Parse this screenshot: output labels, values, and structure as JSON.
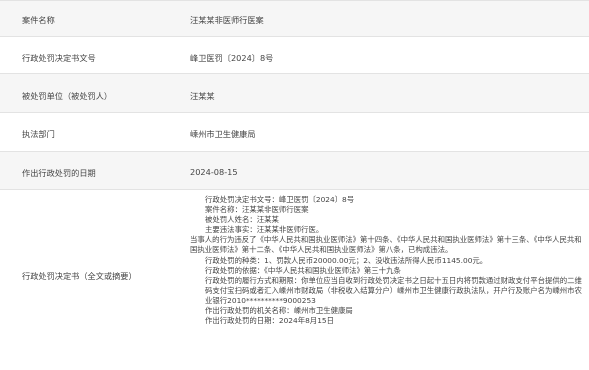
{
  "rows": [
    {
      "label": "案件名称",
      "value": "汪某某非医师行医案"
    },
    {
      "label": "行政处罚决定书文号",
      "value": "峰卫医罚〔2024〕8号"
    },
    {
      "label": "被处罚单位（被处罚人）",
      "value": "汪某某"
    },
    {
      "label": "执法部门",
      "value": "嵊州市卫生健康局"
    },
    {
      "label": "作出行政处罚的日期",
      "value": "2024-08-15"
    }
  ],
  "decision": {
    "label": "行政处罚决定书（全文或摘要）",
    "lines": [
      "行政处罚决定书文号：峰卫医罚〔2024〕8号",
      "案件名称：汪某某非医师行医案",
      "被处罚人姓名：汪某某",
      "主要违法事实：汪某某非医师行医。",
      "当事人的行为违反了《中华人民共和国执业医师法》第十四条、《中华人民共和国执业医师法》第十三条、《中华人民共和国执业医师法》第十二条、《中华人民共和国执业医师法》第八条，已构成违法。",
      "行政处罚的种类：1、罚款人民币20000.00元；2、没收违法所得人民币1145.00元。",
      "行政处罚的依据：《中华人民共和国执业医师法》第三十九条",
      "行政处罚的履行方式和期限：你单位应当自收到行政处罚决定书之日起十五日内将罚款通过财政支付平台提供的二维码支付宝扫码或者汇入嵊州市财政局（非税收入结算分户）嵊州市卫生健康行政执法队，开户行及账户名为嵊州市农业银行2010**********9000253",
      "作出行政处罚的机关名称：嵊州市卫生健康局",
      "作出行政处罚的日期：2024年8月15日"
    ]
  },
  "colors": {
    "zebra": "#f6f6f6",
    "border": "#e3e3e3",
    "text": "#444444"
  }
}
